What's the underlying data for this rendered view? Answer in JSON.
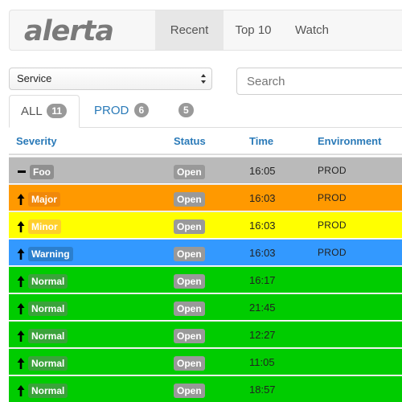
{
  "brand": {
    "logo_text": "alerta"
  },
  "nav": {
    "recent": "Recent",
    "top10": "Top 10",
    "watch": "Watch"
  },
  "filter": {
    "service_selected": "Service",
    "search_placeholder": "Search"
  },
  "tabs": [
    {
      "label": "ALL",
      "count": "11"
    },
    {
      "label": "PROD",
      "count": "6"
    },
    {
      "label": "",
      "count": "5"
    }
  ],
  "table": {
    "headers": {
      "severity": "Severity",
      "status": "Status",
      "time": "Time",
      "environment": "Environment"
    },
    "rows": [
      {
        "severity": "Foo",
        "arrow": "dash",
        "status": "Open",
        "time": "16:05",
        "environment": "PROD",
        "row_color": "#bababa",
        "label_bg": "#8f8f8f",
        "label_fg": "#ffffff"
      },
      {
        "severity": "Major",
        "arrow": "up",
        "status": "Open",
        "time": "16:03",
        "environment": "PROD",
        "row_color": "#ff9900",
        "label_bg": "#f0880a",
        "label_fg": "#ffffff"
      },
      {
        "severity": "Minor",
        "arrow": "up",
        "status": "Open",
        "time": "16:03",
        "environment": "PROD",
        "row_color": "#ffff00",
        "label_bg": "#ffd02b",
        "label_fg": "#ffffff"
      },
      {
        "severity": "Warning",
        "arrow": "up",
        "status": "Open",
        "time": "16:03",
        "environment": "PROD",
        "row_color": "#3399ff",
        "label_bg": "#2b7fce",
        "label_fg": "#ffffff"
      },
      {
        "severity": "Normal",
        "arrow": "up",
        "status": "Open",
        "time": "16:17",
        "environment": "",
        "row_color": "#00cc00",
        "label_bg": "#3aa33a",
        "label_fg": "#ffffff"
      },
      {
        "severity": "Normal",
        "arrow": "up",
        "status": "Open",
        "time": "21:45",
        "environment": "",
        "row_color": "#00cc00",
        "label_bg": "#3aa33a",
        "label_fg": "#ffffff"
      },
      {
        "severity": "Normal",
        "arrow": "up",
        "status": "Open",
        "time": "12:27",
        "environment": "",
        "row_color": "#00cc00",
        "label_bg": "#3aa33a",
        "label_fg": "#ffffff"
      },
      {
        "severity": "Normal",
        "arrow": "up",
        "status": "Open",
        "time": "11:05",
        "environment": "",
        "row_color": "#00cc00",
        "label_bg": "#3aa33a",
        "label_fg": "#ffffff"
      },
      {
        "severity": "Normal",
        "arrow": "up",
        "status": "Open",
        "time": "18:57",
        "environment": "",
        "row_color": "#00cc00",
        "label_bg": "#3aa33a",
        "label_fg": "#ffffff"
      }
    ]
  },
  "colors": {
    "link_blue": "#2a7ab8",
    "badge_gray": "#999999"
  }
}
